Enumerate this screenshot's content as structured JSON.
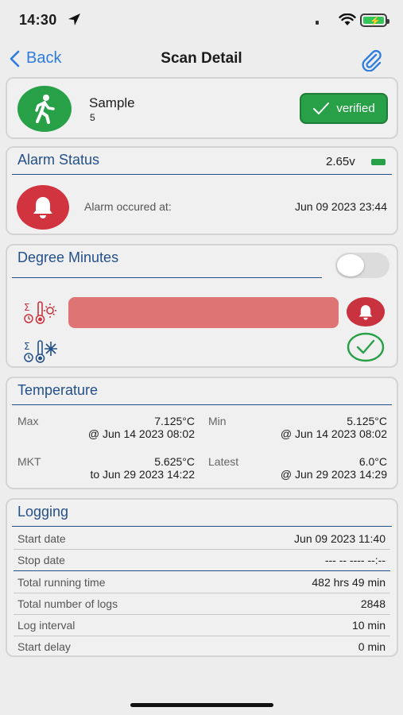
{
  "status_bar": {
    "time": "14:30"
  },
  "nav": {
    "back_label": "Back",
    "title": "Scan Detail"
  },
  "sample": {
    "name": "Sample",
    "number": "5",
    "verified_label": "verified"
  },
  "alarm_status": {
    "title": "Alarm Status",
    "voltage": "2.65v",
    "occurred_label": "Alarm occured at:",
    "occurred_date": "Jun 09 2023 23:44"
  },
  "degree_minutes": {
    "title": "Degree Minutes",
    "toggle_on": false,
    "high_bar_fill": 1.0
  },
  "temperature": {
    "title": "Temperature",
    "max_label": "Max",
    "max_value": "7.125°C",
    "max_time": "@ Jun 14 2023 08:02",
    "min_label": "Min",
    "min_value": "5.125°C",
    "min_time": "@ Jun 14 2023 08:02",
    "mkt_label": "MKT",
    "mkt_value": "5.625°C",
    "mkt_time": "to Jun 29 2023 14:22",
    "latest_label": "Latest",
    "latest_value": "6.0°C",
    "latest_time": "@ Jun 29 2023 14:29"
  },
  "logging": {
    "title": "Logging",
    "rows": [
      {
        "label": "Start date",
        "value": "Jun 09 2023 11:40"
      },
      {
        "label": "Stop date",
        "value": "--- -- ---- --:--"
      },
      {
        "label": "Total running time",
        "value": "482 hrs 49 min"
      },
      {
        "label": "Total number of logs",
        "value": "2848"
      },
      {
        "label": "Log interval",
        "value": "10 min"
      },
      {
        "label": "Start delay",
        "value": "0 min"
      }
    ]
  },
  "colors": {
    "accent_blue": "#2d7cdf",
    "section_blue": "#24508a",
    "ok_green": "#27a048",
    "alarm_red": "#d1333f",
    "bar_red": "#df7474"
  }
}
